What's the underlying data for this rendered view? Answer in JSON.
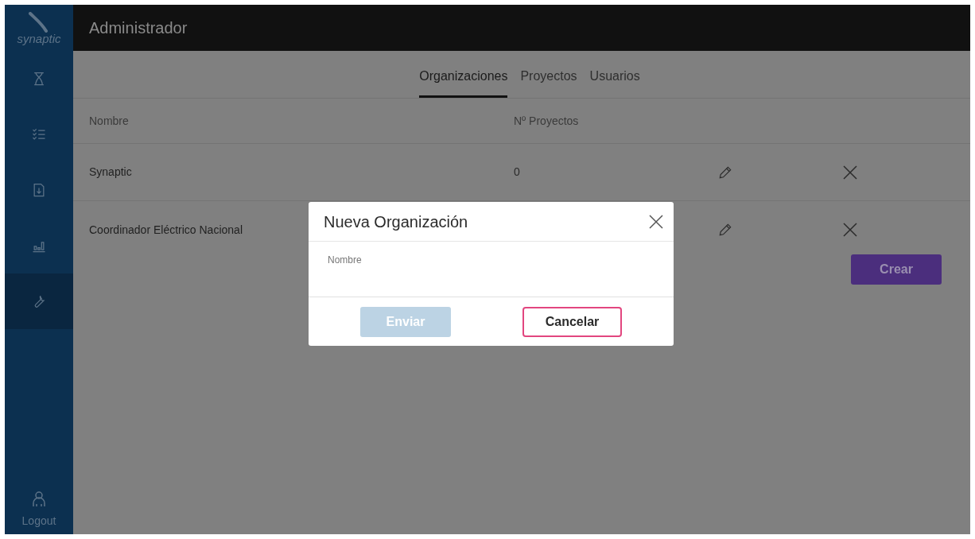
{
  "sidebar": {
    "logo": "synaptic",
    "items": [
      {
        "kind": "hourglass",
        "selected": false
      },
      {
        "kind": "checklist",
        "selected": false
      },
      {
        "kind": "download",
        "selected": false
      },
      {
        "kind": "chart",
        "selected": false
      },
      {
        "kind": "wrench",
        "selected": true
      }
    ],
    "logout": "Logout"
  },
  "header": {
    "title": "Administrador"
  },
  "tabs": [
    {
      "label": "Organizaciones",
      "selected": true
    },
    {
      "label": "Proyectos",
      "selected": false
    },
    {
      "label": "Usuarios",
      "selected": false
    }
  ],
  "table": {
    "columns": [
      "Nombre",
      "Nº Proyectos"
    ],
    "rows": [
      {
        "name": "Synaptic",
        "projects": "0"
      },
      {
        "name": "Coordinador Eléctrico Nacional",
        "projects": ""
      }
    ]
  },
  "create_button": "Crear",
  "dialog": {
    "title": "Nueva Organización",
    "field_label": "Nombre",
    "submit": {
      "label": "Enviar",
      "disabled": true
    },
    "cancel": "Cancelar"
  }
}
